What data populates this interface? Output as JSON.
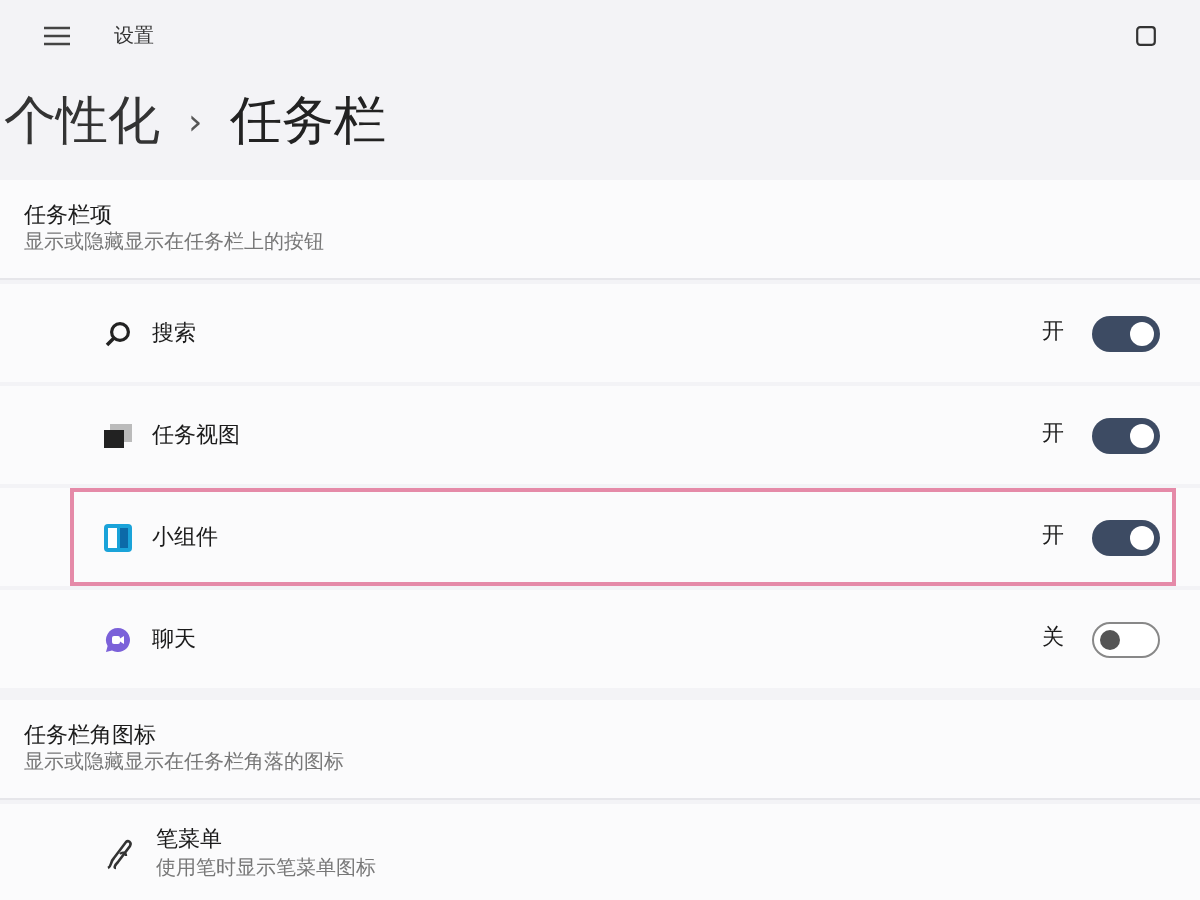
{
  "window": {
    "title": "设置"
  },
  "breadcrumb": {
    "parent": "个性化",
    "separator": "›",
    "current": "任务栏"
  },
  "sections": [
    {
      "title": "任务栏项",
      "subtitle": "显示或隐藏显示在任务栏上的按钮",
      "items": [
        {
          "kind": "search",
          "label": "搜索",
          "state_label": "开",
          "on": true,
          "highlighted": false
        },
        {
          "kind": "taskview",
          "label": "任务视图",
          "state_label": "开",
          "on": true,
          "highlighted": false
        },
        {
          "kind": "widgets",
          "label": "小组件",
          "state_label": "开",
          "on": true,
          "highlighted": true
        },
        {
          "kind": "chat",
          "label": "聊天",
          "state_label": "关",
          "on": false,
          "highlighted": false
        }
      ]
    },
    {
      "title": "任务栏角图标",
      "subtitle": "显示或隐藏显示在任务栏角落的图标",
      "items": [
        {
          "kind": "pen",
          "label": "笔菜单",
          "description": "使用笔时显示笔菜单图标"
        }
      ]
    }
  ]
}
